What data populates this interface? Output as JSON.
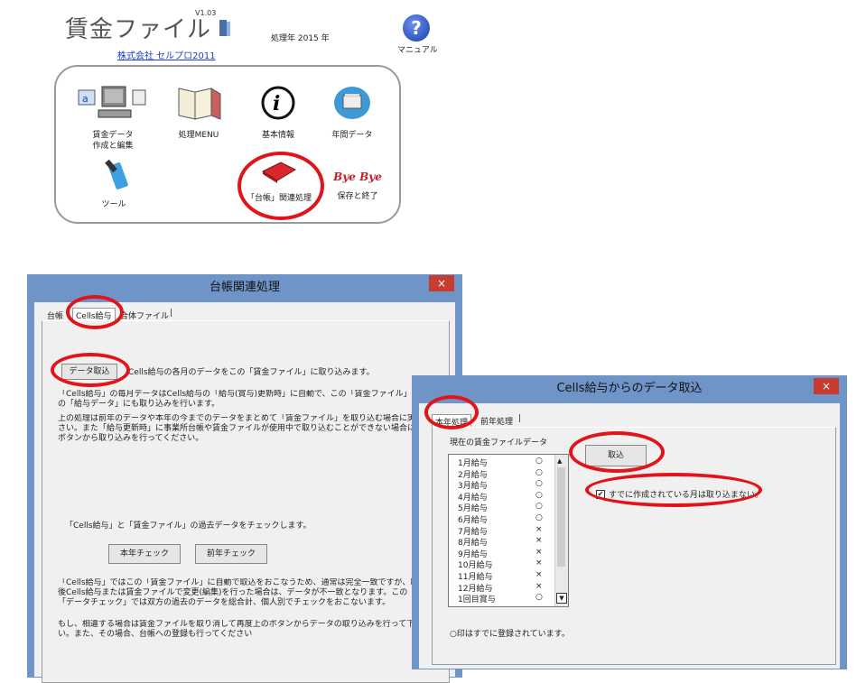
{
  "header": {
    "app_title": "賃金ファイル",
    "version": "V1.03",
    "company": "株式会社 セルプロ2011",
    "year_text": "処理年 2015 年",
    "help_label": "マニュアル"
  },
  "launcher": {
    "items": [
      {
        "label_1": "賃金データ",
        "label_2": "作成と編集"
      },
      {
        "label_1": "処理MENU"
      },
      {
        "label_1": "基本情報"
      },
      {
        "label_1": "年間データ"
      },
      {
        "label_1": "ツール"
      },
      {
        "label_1": "「台帳」関連処理"
      },
      {
        "label_1": "保存と終了",
        "logo_text": "Bye Bye"
      }
    ]
  },
  "dialog1": {
    "title": "台帳関連処理",
    "close": "×",
    "tabs": [
      "台帳",
      "Cells給与",
      "合体ファイル"
    ],
    "import_button": "データ取込",
    "import_desc": "Cells給与の各月のデータをこの「賃金ファイル」に取り込みます。",
    "para1": "「Cells給与」の毎月データはCells給与の「給与(賞与)更新時」に自動で、この「賃金ファイル」や「台帳",
    "para1b": "の「給与データ」にも取り込みを行います。",
    "para2": "上の処理は前年のデータや本年の今までのデータをまとめて「賃金ファイル」を取り込む場合に実行して",
    "para2b": "さい。また「給与更新時」に事業所台帳や賃金ファイルが使用中で取り込むことができない場合に、上の",
    "para2c": "ボタンから取り込みを行ってください。",
    "check_desc": "「Cells給与」と「賃金ファイル」の過去データをチェックします。",
    "this_year_btn": "本年チェック",
    "prev_year_btn": "前年チェック",
    "para3": "「Cells給与」ではこの「賃金ファイル」に自動で取込をおこなうため、通常は完全一致ですが、取込",
    "para3b": "後Cells給与または賃金ファイルで変更(編集)を行った場合は、データが不一致となります。この",
    "para3c": "「データチェック」では双方の過去のデータを総合計、個人別でチェックをおこないます。",
    "para4": "もし、相違する場合は賃金ファイルを取り消して再度上のボタンからデータの取り込みを行って下さ",
    "para4b": "い。また、その場合、台帳への登録も行ってください"
  },
  "dialog2": {
    "title": "Cells給与からのデータ取込",
    "close": "×",
    "tabs": [
      "本年処理",
      "前年処理"
    ],
    "list_caption": "現在の賃金ファイルデータ",
    "months": [
      {
        "name": "1月給与",
        "mark": "○"
      },
      {
        "name": "2月給与",
        "mark": "○"
      },
      {
        "name": "3月給与",
        "mark": "○"
      },
      {
        "name": "4月給与",
        "mark": "○"
      },
      {
        "name": "5月給与",
        "mark": "○"
      },
      {
        "name": "6月給与",
        "mark": "○"
      },
      {
        "name": "7月給与",
        "mark": "×"
      },
      {
        "name": "8月給与",
        "mark": "×"
      },
      {
        "name": "9月給与",
        "mark": "×"
      },
      {
        "name": "10月給与",
        "mark": "×"
      },
      {
        "name": "11月給与",
        "mark": "×"
      },
      {
        "name": "12月給与",
        "mark": "×"
      },
      {
        "name": "1回目賞与",
        "mark": "○"
      }
    ],
    "import_btn": "取込",
    "skip_checkbox": "すでに作成されている月は取り込まない。",
    "skip_checked": true,
    "footnote": "○印はすでに登録されています。"
  }
}
